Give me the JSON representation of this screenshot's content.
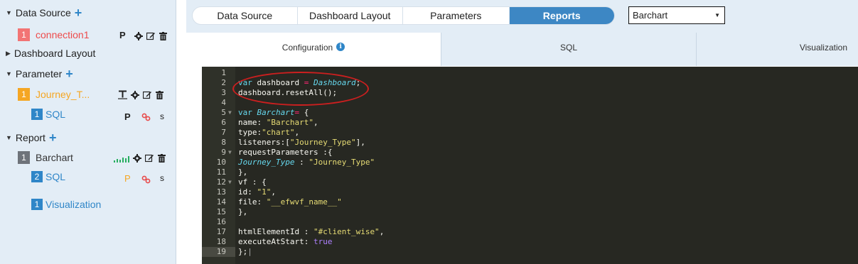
{
  "sidebar": {
    "data_source": {
      "label": "Data Source",
      "connection": {
        "badge": "1",
        "label": "connection1",
        "action": "P"
      }
    },
    "dashboard_layout": {
      "label": "Dashboard Layout"
    },
    "parameter": {
      "label": "Parameter",
      "item": {
        "badge": "1",
        "label": "Journey_T..."
      },
      "sql": {
        "badge": "1",
        "label": "SQL",
        "action_p": "P",
        "action_s": "s"
      }
    },
    "report": {
      "label": "Report",
      "item": {
        "badge": "1",
        "label": "Barchart"
      },
      "sql": {
        "badge": "2",
        "label": "SQL",
        "action_p": "P",
        "action_s": "s"
      },
      "visualization": {
        "badge": "1",
        "label": "Visualization"
      }
    }
  },
  "top_tabs": [
    "Data Source",
    "Dashboard Layout",
    "Parameters",
    "Reports"
  ],
  "active_top_tab": "Reports",
  "report_select": {
    "value": "Barchart"
  },
  "sub_tabs": [
    "Configuration",
    "SQL",
    "Visualization"
  ],
  "active_sub_tab": "Configuration",
  "editor": {
    "line_numbers": [
      "1",
      "2",
      "3",
      "4",
      "5",
      "6",
      "7",
      "8",
      "9",
      "10",
      "11",
      "12",
      "13",
      "14",
      "15",
      "16",
      "17",
      "18",
      "19"
    ],
    "active_line": "19"
  },
  "colors": {
    "accent": "#3d87c4",
    "sidebar_bg": "#e3edf6",
    "editor_bg": "#272822",
    "annotation": "#cc1f1f"
  }
}
